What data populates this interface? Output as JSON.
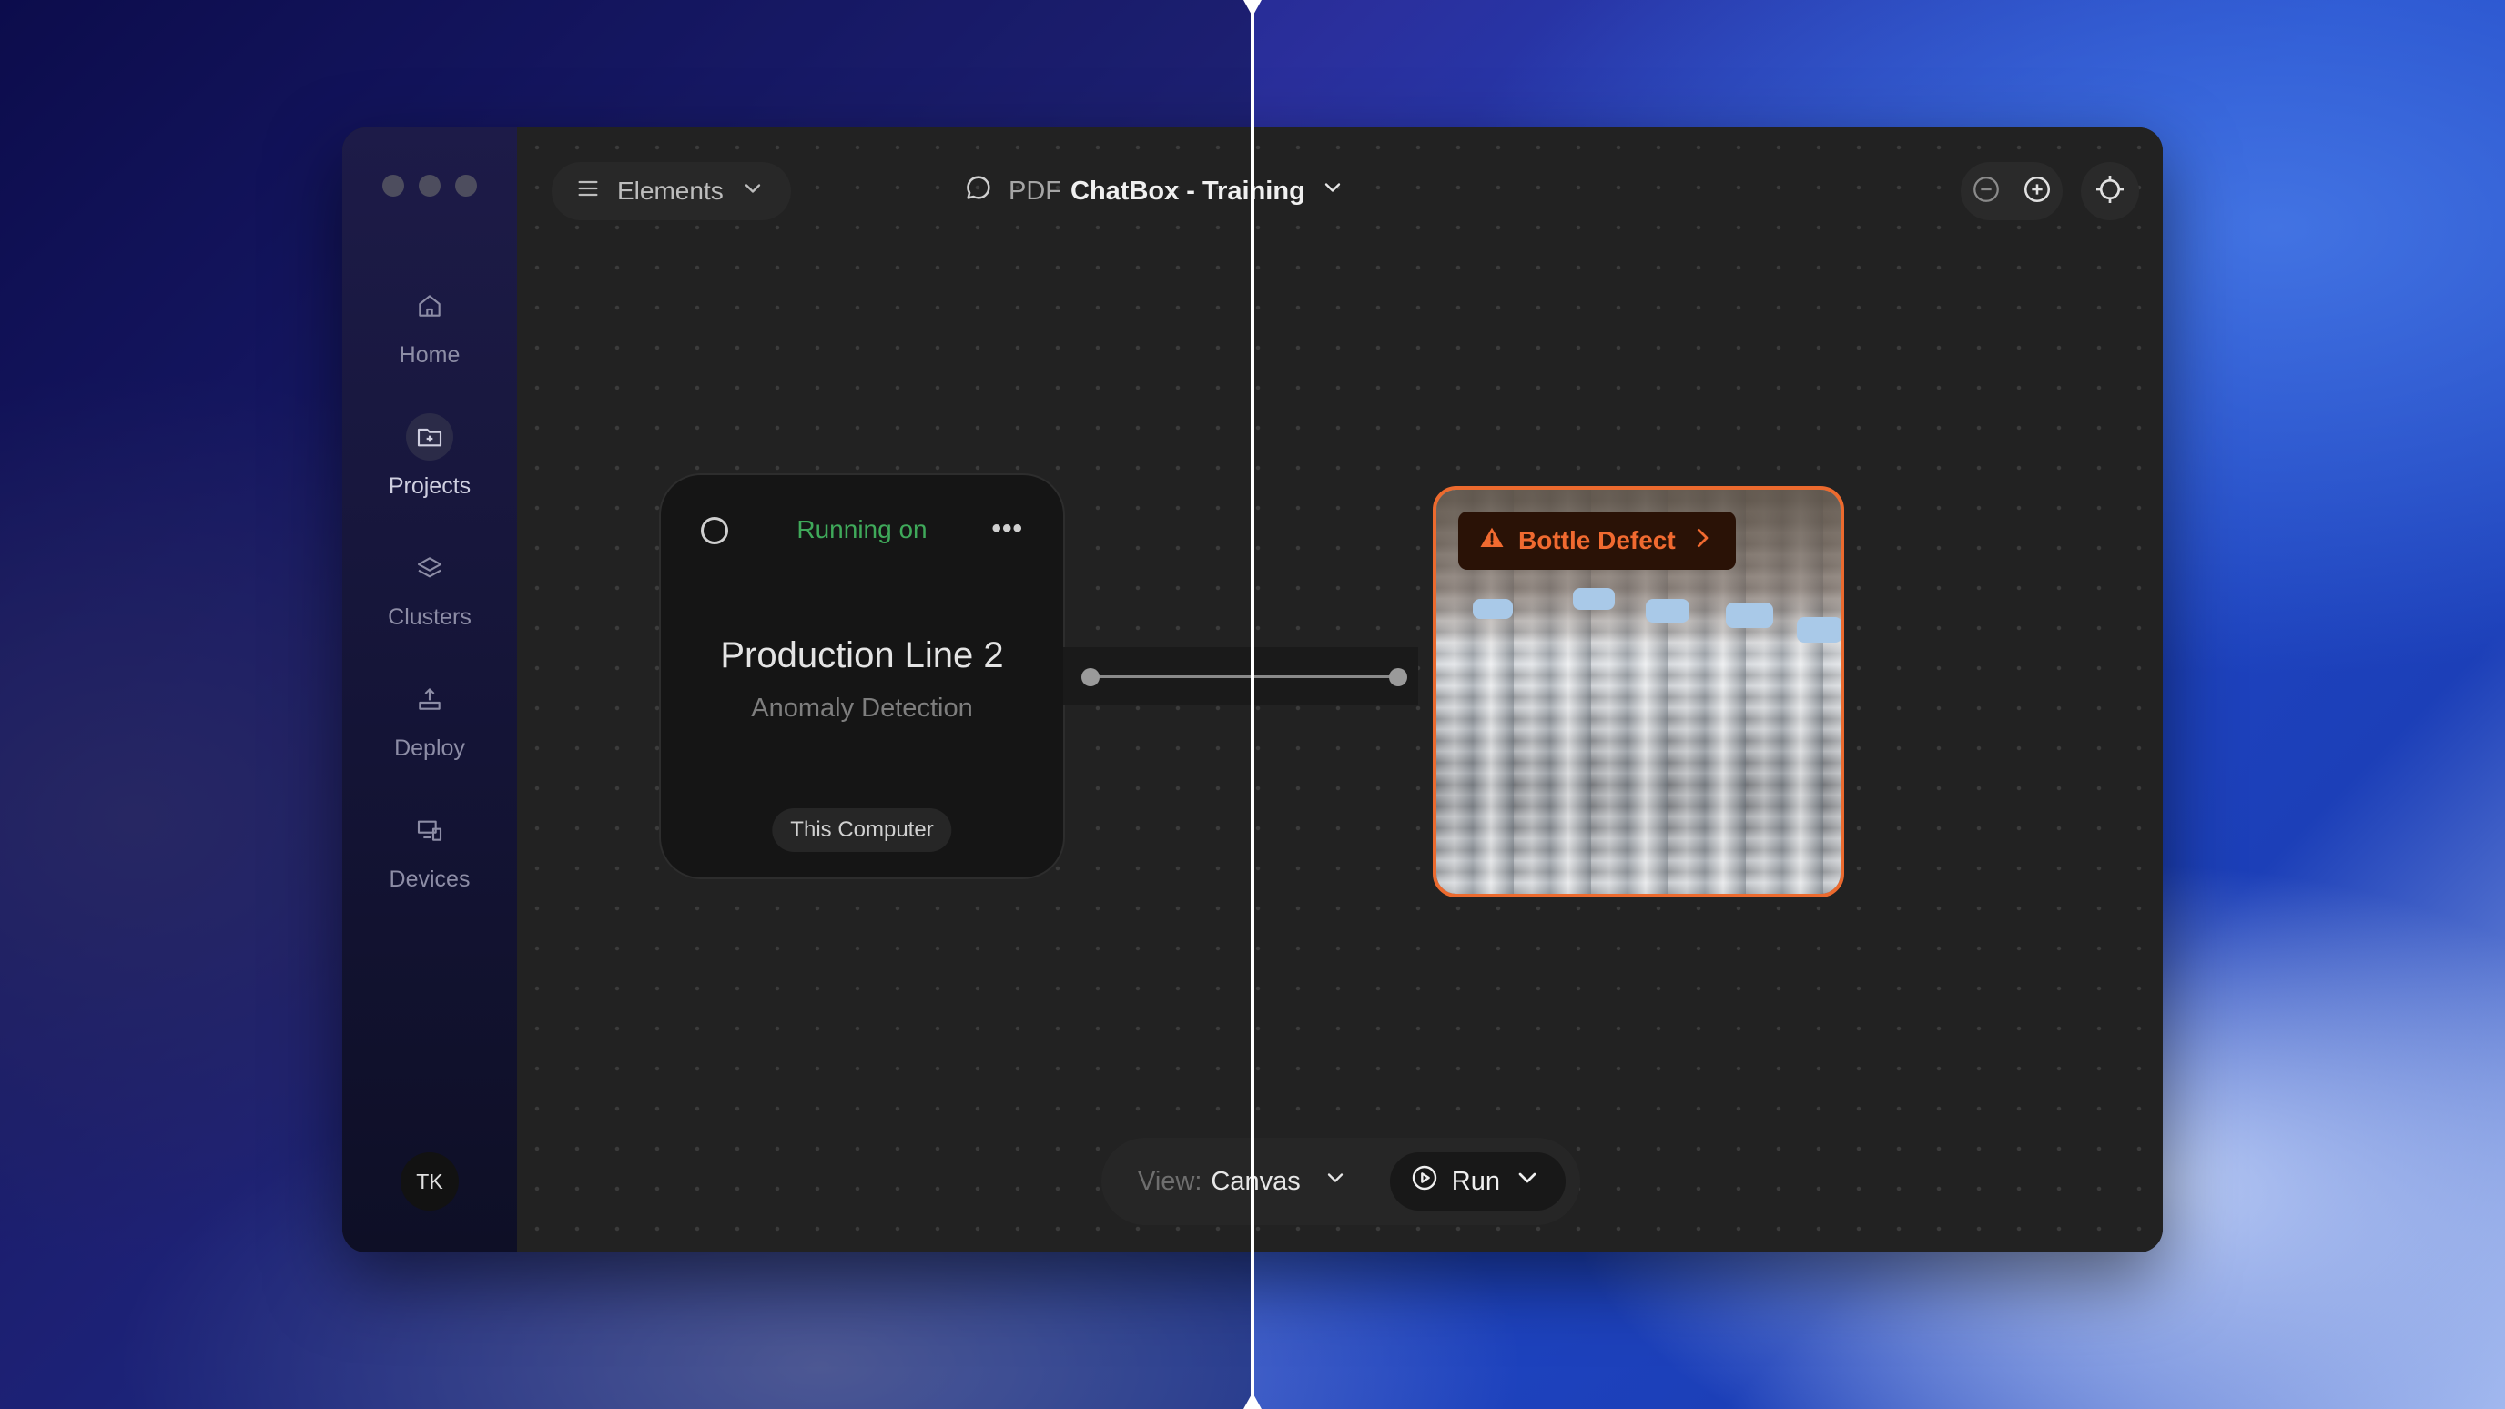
{
  "sidebar": {
    "items": [
      {
        "label": "Home",
        "icon": "home-icon"
      },
      {
        "label": "Projects",
        "icon": "folder-plus-icon",
        "active": true
      },
      {
        "label": "Clusters",
        "icon": "layers-icon"
      },
      {
        "label": "Deploy",
        "icon": "upload-icon"
      },
      {
        "label": "Devices",
        "icon": "devices-icon"
      }
    ],
    "avatar_initials": "TK"
  },
  "toolbar": {
    "elements_label": "Elements",
    "title_prefix": "PDF",
    "title_main": "ChatBox - Training"
  },
  "node": {
    "status": "Running on",
    "title": "Production Line 2",
    "subtitle": "Anomaly Detection",
    "device": "This Computer"
  },
  "alert": {
    "label": "Bottle Defect",
    "color": "#ec6a2e"
  },
  "bottom": {
    "view_key": "View:",
    "view_value": "Canvas",
    "run_label": "Run"
  }
}
